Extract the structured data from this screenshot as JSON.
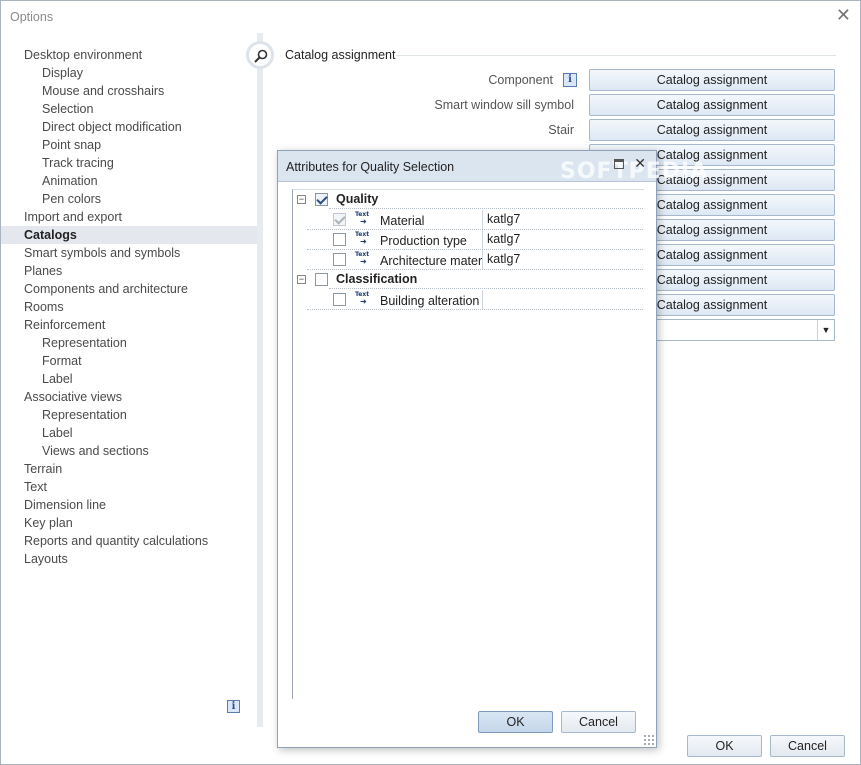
{
  "window": {
    "title": "Options",
    "close": "✕"
  },
  "sidebar": {
    "items": [
      {
        "label": "Desktop environment",
        "level": 0
      },
      {
        "label": "Display",
        "level": 1
      },
      {
        "label": "Mouse and crosshairs",
        "level": 1
      },
      {
        "label": "Selection",
        "level": 1
      },
      {
        "label": "Direct object modification",
        "level": 1
      },
      {
        "label": "Point snap",
        "level": 1
      },
      {
        "label": "Track tracing",
        "level": 1
      },
      {
        "label": "Animation",
        "level": 1
      },
      {
        "label": "Pen colors",
        "level": 1
      },
      {
        "label": "Import and export",
        "level": 0
      },
      {
        "label": "Catalogs",
        "level": 0,
        "selected": true
      },
      {
        "label": "Smart symbols and symbols",
        "level": 0
      },
      {
        "label": "Planes",
        "level": 0
      },
      {
        "label": "Components and architecture",
        "level": 0
      },
      {
        "label": "Rooms",
        "level": 0
      },
      {
        "label": "Reinforcement",
        "level": 0
      },
      {
        "label": "Representation",
        "level": 1
      },
      {
        "label": "Format",
        "level": 1
      },
      {
        "label": "Label",
        "level": 1
      },
      {
        "label": "Associative views",
        "level": 0
      },
      {
        "label": "Representation",
        "level": 1
      },
      {
        "label": "Label",
        "level": 1
      },
      {
        "label": "Views and sections",
        "level": 1
      },
      {
        "label": "Terrain",
        "level": 0
      },
      {
        "label": "Text",
        "level": 0
      },
      {
        "label": "Dimension line",
        "level": 0
      },
      {
        "label": "Key plan",
        "level": 0
      },
      {
        "label": "Reports and quantity calculations",
        "level": 0
      },
      {
        "label": "Layouts",
        "level": 0
      }
    ],
    "info_icon": "i"
  },
  "main": {
    "section_title": "Catalog assignment",
    "rows": [
      {
        "label": "Component",
        "button": "Catalog assignment",
        "info": "i"
      },
      {
        "label": "Smart window sill symbol",
        "button": "Catalog assignment"
      },
      {
        "label": "Stair",
        "button": "Catalog assignment"
      },
      {
        "label": "",
        "button": "Catalog assignment"
      },
      {
        "label": "",
        "button": "Catalog assignment"
      },
      {
        "label": "",
        "button": "Catalog assignment"
      },
      {
        "label": "",
        "button": "Catalog assignment"
      },
      {
        "label": "",
        "button": "Catalog assignment"
      },
      {
        "label": "",
        "button": "Catalog assignment"
      },
      {
        "label": "",
        "button": "Catalog assignment"
      }
    ],
    "combo_arrow": "▼",
    "ok": "OK",
    "cancel": "Cancel"
  },
  "dialog": {
    "title": "Attributes for Quality Selection",
    "watermark": "SOFTPEDIA",
    "groups": [
      {
        "label": "Quality",
        "checked": true,
        "items": [
          {
            "name": "Material",
            "value": "katlg7",
            "checked": true,
            "disabled": true
          },
          {
            "name": "Production type",
            "value": "katlg7",
            "checked": false
          },
          {
            "name": "Architecture material",
            "value": "katlg7",
            "checked": false
          }
        ]
      },
      {
        "label": "Classification",
        "checked": false,
        "items": [
          {
            "name": "Building alteration category",
            "value": "",
            "checked": false
          }
        ]
      }
    ],
    "text_icon_label": "Text",
    "ok": "OK",
    "cancel": "Cancel"
  }
}
